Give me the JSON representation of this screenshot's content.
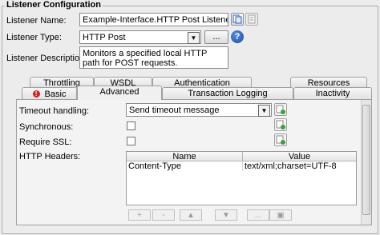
{
  "section_title": "Listener Configuration",
  "listener_name": {
    "label": "Listener Name:",
    "value": "Example-Interface.HTTP Post Listener"
  },
  "listener_type": {
    "label": "Listener Type:",
    "value": "HTTP Post",
    "more_button": "..."
  },
  "listener_description": {
    "label": "Listener Description:",
    "value": "Monitors a specified local HTTP path for POST requests."
  },
  "tabs_back": [
    "Throttling",
    "WSDL",
    "Authentication",
    "Resources"
  ],
  "tabs_front": [
    "Basic",
    "Advanced",
    "Transaction Logging",
    "Inactivity"
  ],
  "active_tab": "Advanced",
  "advanced": {
    "timeout_label": "Timeout handling:",
    "timeout_value": "Send timeout message",
    "synchronous_label": "Synchronous:",
    "require_ssl_label": "Require SSL:",
    "http_headers_label": "HTTP Headers:",
    "table": {
      "columns": [
        "Name",
        "Value"
      ],
      "rows": [
        [
          "Content-Type",
          "text/xml;charset=UTF-8"
        ]
      ]
    },
    "toolbar": [
      "+",
      "-",
      "▲",
      "▼",
      "...",
      "▣"
    ]
  }
}
